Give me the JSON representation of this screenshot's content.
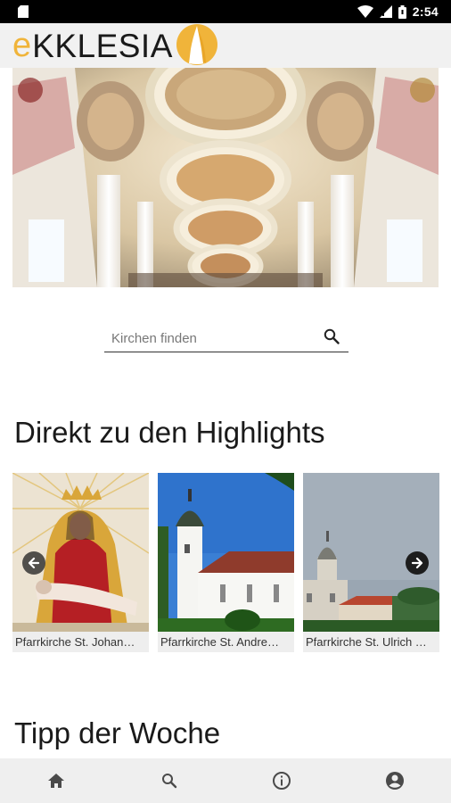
{
  "status_bar": {
    "time": "2:54",
    "icons": [
      "sd-card-icon",
      "wifi-icon",
      "signal-icon",
      "battery-icon"
    ]
  },
  "header": {
    "brand_prefix": "e",
    "brand_name": "KKLESIA",
    "brand_color": "#f0b43a",
    "logo_icon": "church-logo-icon"
  },
  "hero": {
    "image": "baroque-church-ceiling-fresco"
  },
  "search": {
    "placeholder": "Kirchen finden",
    "value": "",
    "icon": "search-icon"
  },
  "highlights": {
    "title": "Direkt zu den Highlights",
    "cards": [
      {
        "label": "Pfarrkirche St. Johan…",
        "image": "pieta-statue"
      },
      {
        "label": "Pfarrkirche St. Andre…",
        "image": "white-church-tower"
      },
      {
        "label": "Pfarrkirche St. Ulrich …",
        "image": "town-skyline-church"
      }
    ],
    "prev_icon": "arrow-left-icon",
    "next_icon": "arrow-right-icon"
  },
  "tipp": {
    "title": "Tipp der Woche"
  },
  "bottom_nav": {
    "items": [
      {
        "icon": "home-icon"
      },
      {
        "icon": "search-icon"
      },
      {
        "icon": "info-icon"
      },
      {
        "icon": "account-icon"
      }
    ]
  }
}
